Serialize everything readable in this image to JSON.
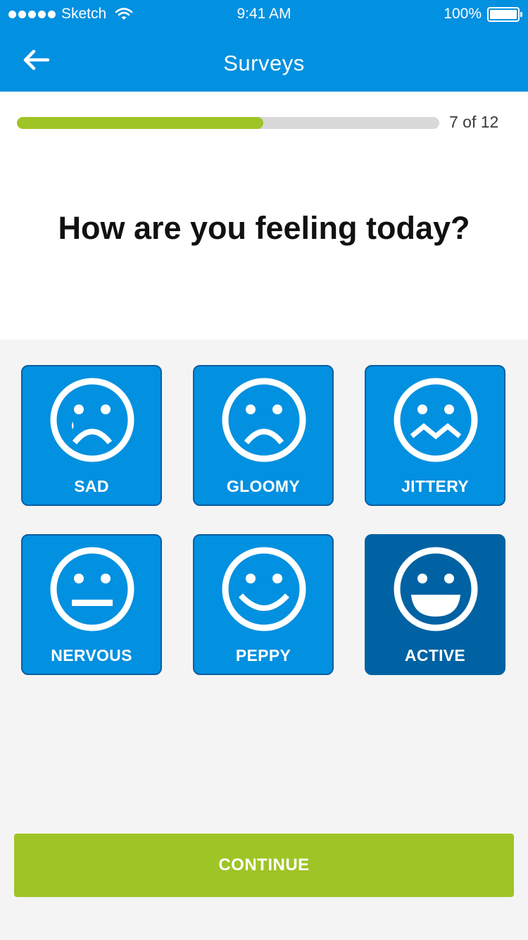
{
  "status_bar": {
    "carrier": "Sketch",
    "time": "9:41 AM",
    "battery": "100%"
  },
  "nav": {
    "title": "Surveys",
    "back_icon": "arrow-left-icon"
  },
  "progress": {
    "value": 7,
    "total": 12,
    "label": "7 of 12",
    "fraction": 0.583
  },
  "question": "How are you feeling today?",
  "moods": [
    {
      "label": "SAD",
      "icon": "sad-tear-face-icon",
      "selected": false
    },
    {
      "label": "GLOOMY",
      "icon": "frown-face-icon",
      "selected": false
    },
    {
      "label": "JITTERY",
      "icon": "zigzag-mouth-face-icon",
      "selected": false
    },
    {
      "label": "NERVOUS",
      "icon": "neutral-face-icon",
      "selected": false
    },
    {
      "label": "PEPPY",
      "icon": "smile-face-icon",
      "selected": false
    },
    {
      "label": "ACTIVE",
      "icon": "open-grin-face-icon",
      "selected": true
    }
  ],
  "continue_label": "CONTINUE",
  "colors": {
    "primary": "#0290e0",
    "selected": "#0062a3",
    "accent": "#9fc426"
  }
}
